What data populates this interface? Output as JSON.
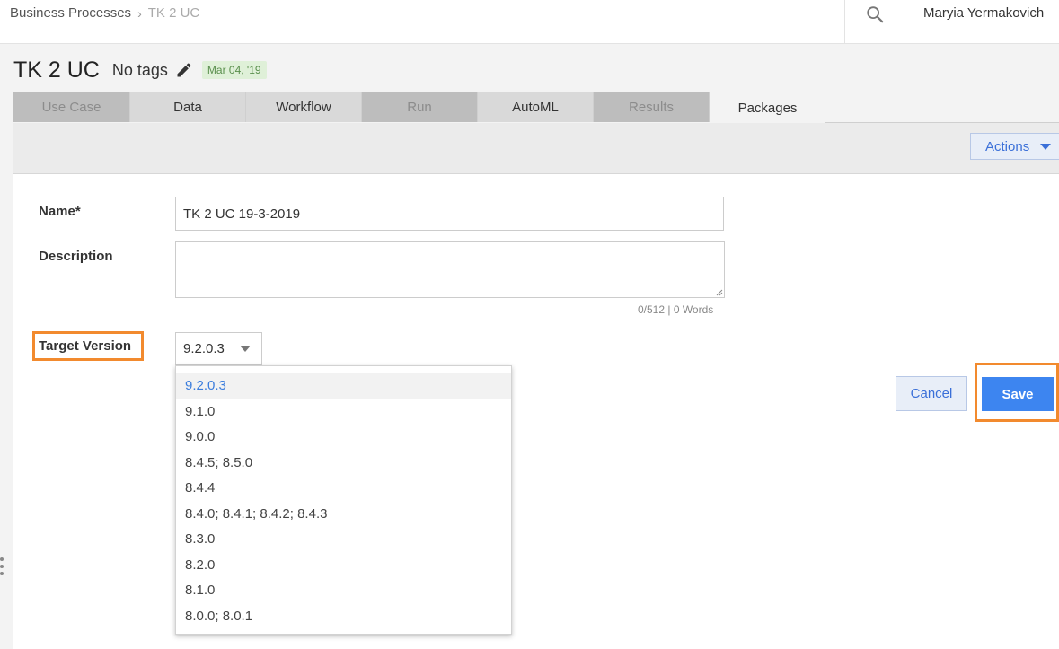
{
  "breadcrumb": {
    "root": "Business Processes",
    "current": "TK 2 UC"
  },
  "header": {
    "user_name": "Maryia Yermakovich",
    "search_icon": "search-icon"
  },
  "page": {
    "title": "TK 2 UC",
    "tags": "No tags",
    "tag_edit_icon": "pencil-icon",
    "date_badge": "Mar 04, '19"
  },
  "tabs": [
    {
      "label": "Use Case",
      "state": "disabled"
    },
    {
      "label": "Data",
      "state": "enabled"
    },
    {
      "label": "Workflow",
      "state": "enabled"
    },
    {
      "label": "Run",
      "state": "disabled"
    },
    {
      "label": "AutoML",
      "state": "enabled"
    },
    {
      "label": "Results",
      "state": "disabled"
    },
    {
      "label": "Packages",
      "state": "active"
    }
  ],
  "toolbar": {
    "actions_label": "Actions"
  },
  "form": {
    "name_label": "Name*",
    "name_value": "TK 2 UC 19-3-2019",
    "description_label": "Description",
    "description_value": "",
    "description_counter": "0/512 | 0 Words",
    "target_version_label": "Target Version",
    "target_version_value": "9.2.0.3",
    "target_version_options": [
      "9.2.0.3",
      "9.1.0",
      "9.0.0",
      "8.4.5; 8.5.0",
      "8.4.4",
      "8.4.0; 8.4.1; 8.4.2; 8.4.3",
      "8.3.0",
      "8.2.0",
      "8.1.0",
      "8.0.0; 8.0.1"
    ]
  },
  "buttons": {
    "cancel_label": "Cancel",
    "save_label": "Save"
  },
  "colors": {
    "accent": "#3d85f0",
    "highlight": "#f28a2e",
    "date_badge_bg": "#dff0d8"
  }
}
